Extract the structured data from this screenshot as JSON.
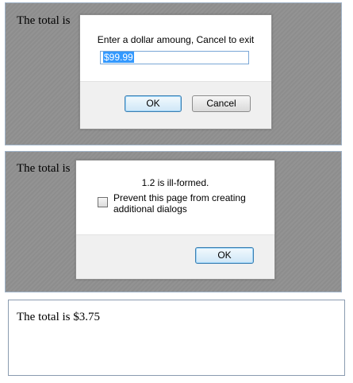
{
  "panel1": {
    "total_label": "The total is",
    "prompt": {
      "message": "Enter a dollar amoung, Cancel to exit",
      "input_value": "$99.99",
      "ok_label": "OK",
      "cancel_label": "Cancel"
    }
  },
  "panel2": {
    "total_label": "The total is",
    "alert": {
      "message": "1.2 is ill-formed.",
      "checkbox_label": "Prevent this page from creating additional dialogs",
      "checkbox_checked": false,
      "ok_label": "OK"
    }
  },
  "panel3": {
    "total_text": "The total is $3.75"
  }
}
